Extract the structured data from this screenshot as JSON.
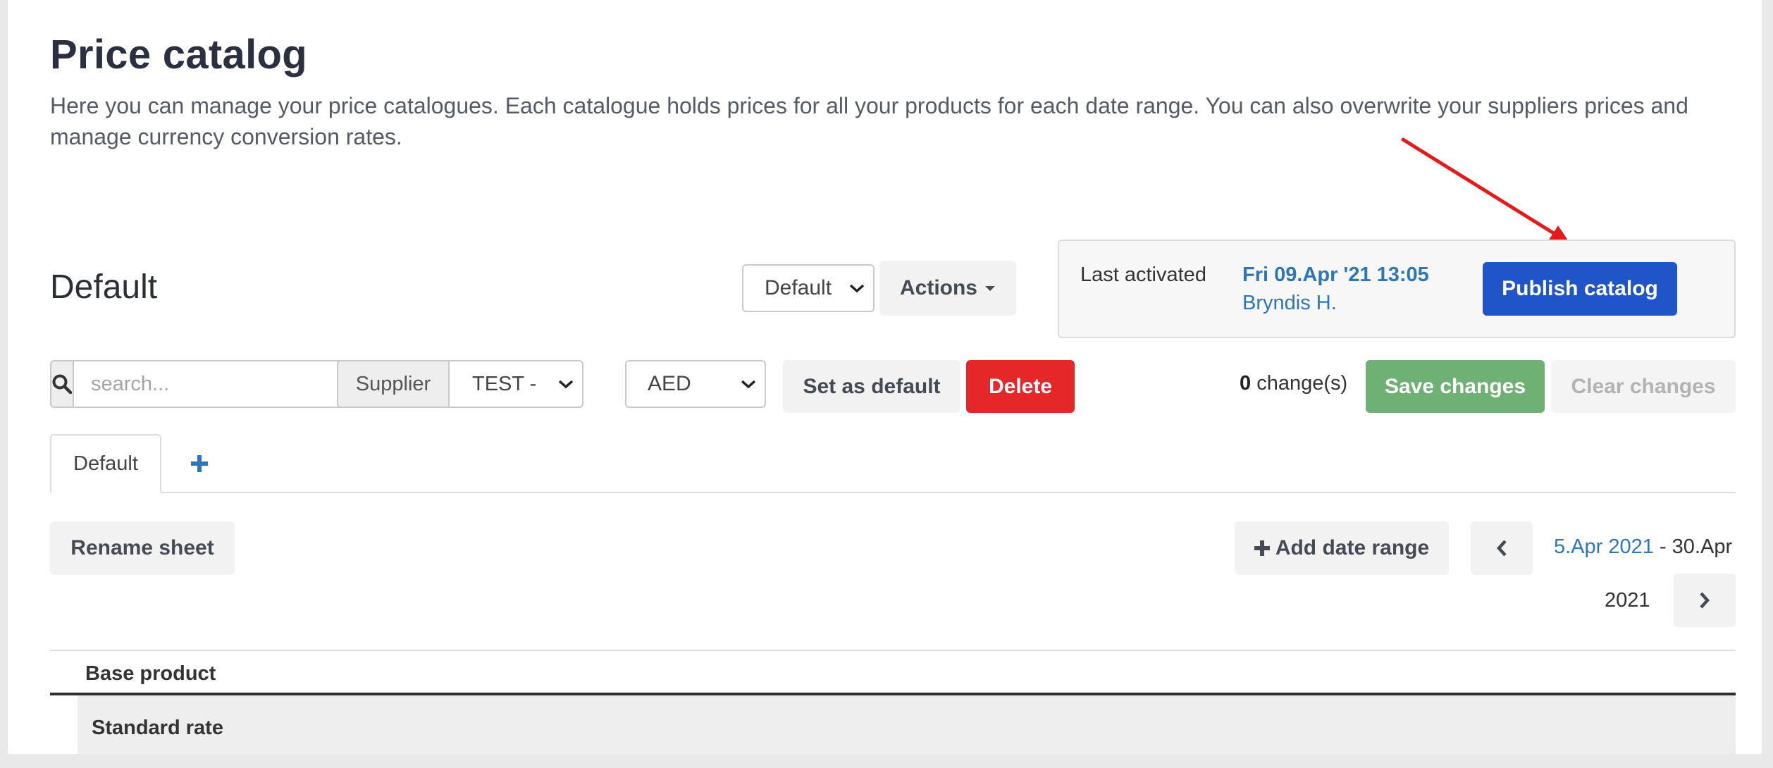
{
  "header": {
    "title": "Price catalog",
    "description": "Here you can manage your price catalogues. Each catalogue holds prices for all your products for each date range. You can also overwrite your suppliers prices and manage currency conversion rates."
  },
  "catalog": {
    "title": "Default",
    "selector_value": "Default",
    "actions_label": "Actions"
  },
  "activation": {
    "label": "Last activated",
    "date": "Fri 09.Apr '21 13:05",
    "user": "Bryndis H.",
    "publish_label": "Publish catalog"
  },
  "toolbar": {
    "search_placeholder": "search...",
    "supplier_label": "Supplier",
    "supplier_value": "TEST -",
    "currency_value": "AED",
    "set_default_label": "Set as default",
    "delete_label": "Delete",
    "changes_count": "0",
    "changes_label": "change(s)",
    "save_label": "Save changes",
    "clear_label": "Clear changes"
  },
  "tabs": [
    {
      "label": "Default",
      "active": true
    }
  ],
  "sheet": {
    "rename_label": "Rename sheet",
    "add_date_range_label": "Add date range",
    "date_start": "5.Apr 2021",
    "date_separator": " - ",
    "date_end_line1": "30.Apr",
    "date_end_line2": "2021"
  },
  "table": {
    "column_header": "Base product",
    "group_row": "Standard rate"
  },
  "colors": {
    "publish": "#1f55c9",
    "delete": "#e5272a",
    "save": "#6fb074",
    "link": "#2e76b8",
    "annotation_arrow": "#e31b1b"
  },
  "icons": {
    "search": "search-icon",
    "caret": "caret-down-icon",
    "plus": "plus-icon",
    "prev": "chevron-left-icon",
    "next": "chevron-right-icon",
    "arrow": "arrow-annotation-icon"
  }
}
